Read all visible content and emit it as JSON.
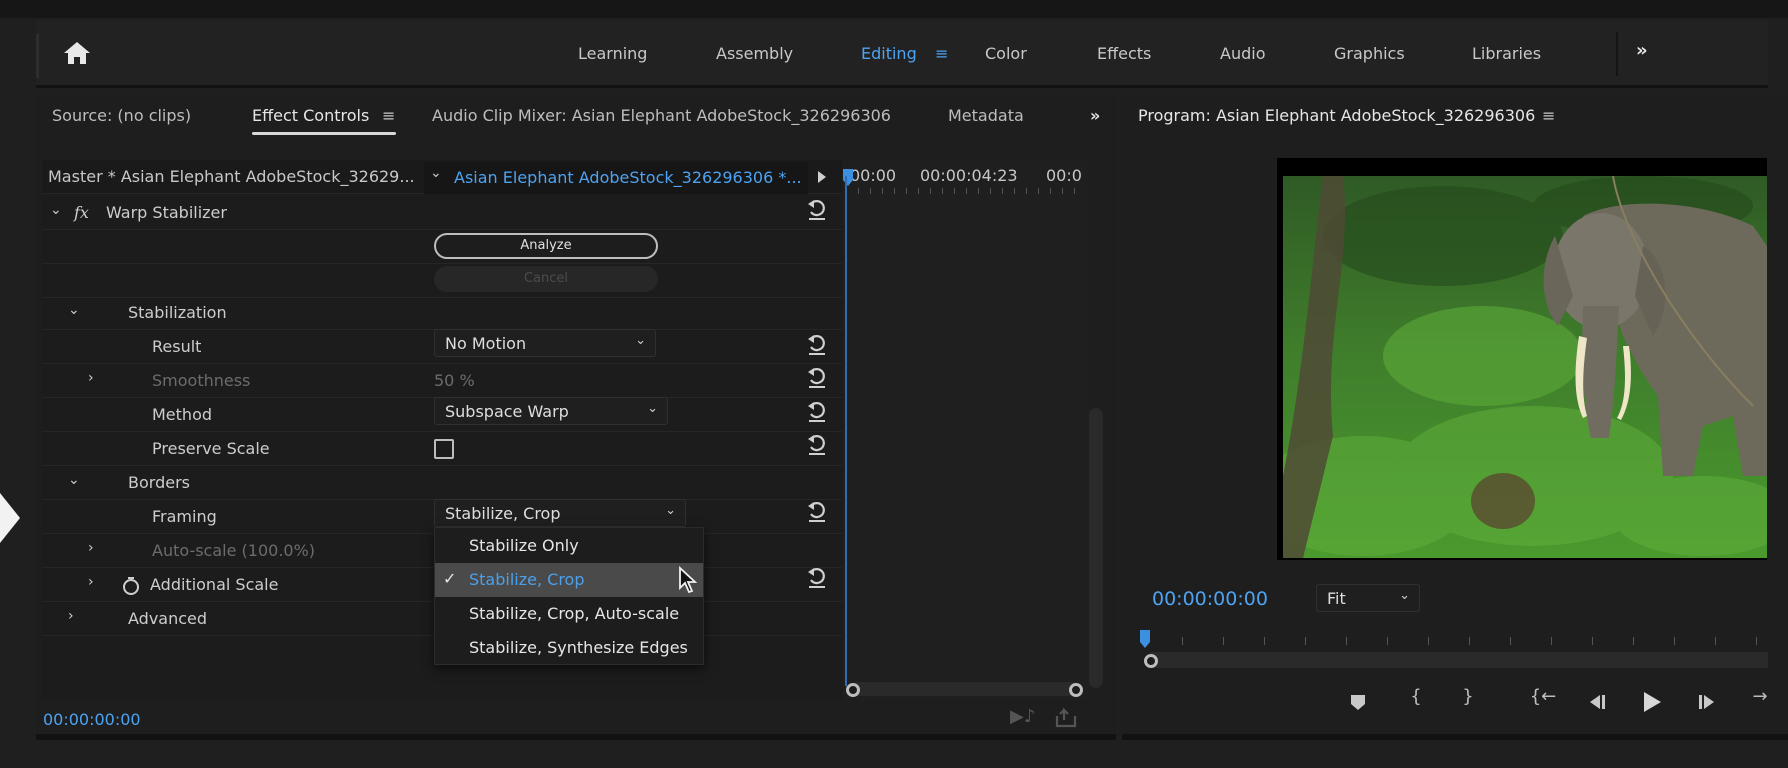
{
  "workspace_bar": {
    "home_icon": "home-icon",
    "tabs": [
      {
        "label": "Learning",
        "active": false
      },
      {
        "label": "Assembly",
        "active": false
      },
      {
        "label": "Editing",
        "active": true
      },
      {
        "label": "Color",
        "active": false
      },
      {
        "label": "Effects",
        "active": false
      },
      {
        "label": "Audio",
        "active": false
      },
      {
        "label": "Graphics",
        "active": false
      },
      {
        "label": "Libraries",
        "active": false
      }
    ],
    "editing_menu_icon": "≡",
    "more_icon": "»"
  },
  "left_panel": {
    "tabs": [
      {
        "label": "Source: (no clips)",
        "active": false
      },
      {
        "label": "Effect Controls",
        "active": true
      },
      {
        "label": "Audio Clip Mixer: Asian Elephant AdobeStock_326296306",
        "active": false
      },
      {
        "label": "Metadata",
        "active": false
      }
    ],
    "menu_icon": "≡",
    "more_icon": "»",
    "master_clip": "Master * Asian Elephant AdobeStock_32629...",
    "sequence_clip": "Asian Elephant AdobeStock_326296306 *...",
    "effect": {
      "name": "Warp Stabilizer",
      "fx_label": "fx",
      "analyze_label": "Analyze",
      "cancel_label": "Cancel",
      "groups": {
        "stabilization": "Stabilization",
        "borders": "Borders",
        "advanced": "Advanced"
      },
      "properties": {
        "result": {
          "label": "Result",
          "value": "No Motion"
        },
        "smoothness": {
          "label": "Smoothness",
          "value": "50 %"
        },
        "method": {
          "label": "Method",
          "value": "Subspace Warp"
        },
        "preserve_scale": {
          "label": "Preserve Scale",
          "checked": false
        },
        "framing": {
          "label": "Framing",
          "value": "Stabilize, Crop"
        },
        "auto_scale": {
          "label": "Auto-scale (100.0%)"
        },
        "additional_scale": {
          "label": "Additional Scale"
        }
      }
    },
    "framing_menu": {
      "options": [
        {
          "label": "Stabilize Only",
          "selected": false
        },
        {
          "label": "Stabilize, Crop",
          "selected": true
        },
        {
          "label": "Stabilize, Crop, Auto-scale",
          "selected": false
        },
        {
          "label": "Stabilize, Synthesize Edges",
          "selected": false
        }
      ],
      "check_icon": "✓"
    },
    "mini_timeline": {
      "ticks": [
        "00:00",
        "00:00:04:23",
        "00:0"
      ]
    },
    "footer_timecode": "00:00:00:00"
  },
  "program_monitor": {
    "title": "Program: Asian Elephant AdobeStock_326296306",
    "menu_icon": "≡",
    "timecode": "00:00:00:00",
    "zoom": "Fit",
    "controls": [
      "add-marker",
      "mark-in",
      "mark-out",
      "go-to-in",
      "step-back",
      "play",
      "step-forward",
      "go-to-out"
    ]
  },
  "colors": {
    "accent": "#4da3f2",
    "panel_bg": "#1e1e1e",
    "selected_menu_bg": "#4a4a4a"
  }
}
